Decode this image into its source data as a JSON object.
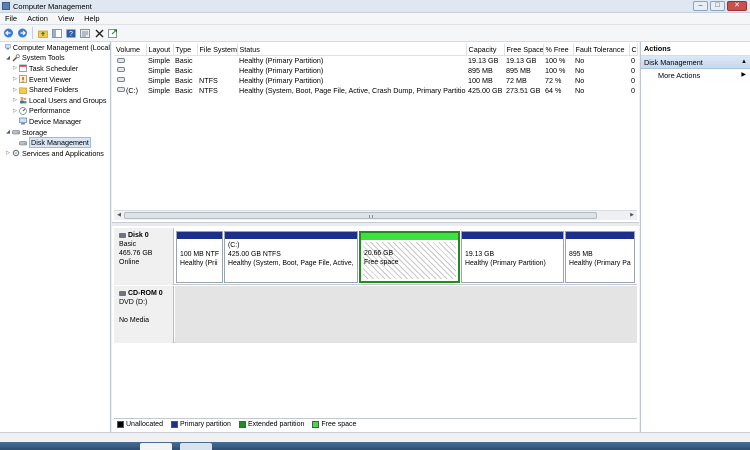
{
  "window": {
    "title": "Computer Management",
    "min": "–",
    "max": "□",
    "close": "✕"
  },
  "menu": [
    "File",
    "Action",
    "View",
    "Help"
  ],
  "toolbar": {
    "icons": [
      "back-arrow-icon",
      "forward-arrow-icon",
      "up-folder-icon",
      "show-hide-tree-icon",
      "help-icon",
      "properties-icon",
      "delete-icon",
      "export-icon"
    ]
  },
  "tree": {
    "root": "Computer Management (Local",
    "system_tools": "System Tools",
    "task_scheduler": "Task Scheduler",
    "event_viewer": "Event Viewer",
    "shared_folders": "Shared Folders",
    "local_users": "Local Users and Groups",
    "performance": "Performance",
    "device_manager": "Device Manager",
    "storage": "Storage",
    "disk_management": "Disk Management",
    "services": "Services and Applications"
  },
  "volume_table": {
    "headers": [
      "Volume",
      "Layout",
      "Type",
      "File System",
      "Status",
      "Capacity",
      "Free Space",
      "% Free",
      "Fault Tolerance",
      "C"
    ],
    "rows": [
      {
        "volume": "",
        "layout": "Simple",
        "type": "Basic",
        "fs": "",
        "status": "Healthy (Primary Partition)",
        "capacity": "19.13 GB",
        "free": "19.13 GB",
        "pct": "100 %",
        "fault": "No",
        "c": "0"
      },
      {
        "volume": "",
        "layout": "Simple",
        "type": "Basic",
        "fs": "",
        "status": "Healthy (Primary Partition)",
        "capacity": "895 MB",
        "free": "895 MB",
        "pct": "100 %",
        "fault": "No",
        "c": "0"
      },
      {
        "volume": "",
        "layout": "Simple",
        "type": "Basic",
        "fs": "NTFS",
        "status": "Healthy (Primary Partition)",
        "capacity": "100 MB",
        "free": "72 MB",
        "pct": "72 %",
        "fault": "No",
        "c": "0"
      },
      {
        "volume": "(C:)",
        "layout": "Simple",
        "type": "Basic",
        "fs": "NTFS",
        "status": "Healthy (System, Boot, Page File, Active, Crash Dump, Primary Partition)",
        "capacity": "425.00 GB",
        "free": "273.51 GB",
        "pct": "64 %",
        "fault": "No",
        "c": "0"
      }
    ]
  },
  "disks": {
    "disk0": {
      "name": "Disk 0",
      "type": "Basic",
      "size": "465.76 GB",
      "status": "Online",
      "p1": {
        "size": "100 MB NTF",
        "status": "Healthy (Prii"
      },
      "p2": {
        "label": "(C:)",
        "size": "425.00 GB NTFS",
        "status": "Healthy (System, Boot, Page File, Active,"
      },
      "p3": {
        "size": "20.66 GB",
        "status": "Free space"
      },
      "p4": {
        "size": "19.13 GB",
        "status": "Healthy (Primary Partition)"
      },
      "p5": {
        "size": "895 MB",
        "status": "Healthy (Primary Pa"
      }
    },
    "cdrom0": {
      "name": "CD-ROM 0",
      "type": "DVD (D:)",
      "status": "No Media"
    }
  },
  "legend": [
    {
      "label": "Unallocated",
      "color": "#000000"
    },
    {
      "label": "Primary partition",
      "color": "#1c2f8c"
    },
    {
      "label": "Extended partition",
      "color": "#1f8c1f"
    },
    {
      "label": "Free space",
      "color": "#3ee23e"
    }
  ],
  "actions": {
    "header": "Actions",
    "section": "Disk Management",
    "more": "More Actions",
    "section_caret": "▲",
    "more_caret": "▶"
  }
}
